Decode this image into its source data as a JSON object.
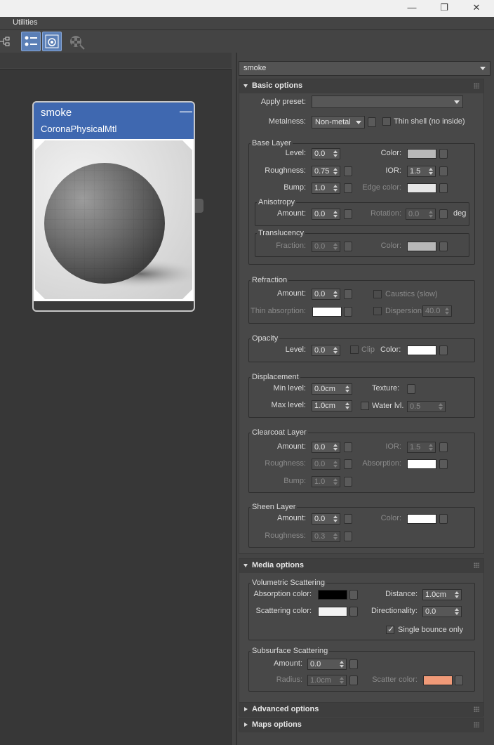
{
  "menu": {
    "utilities": "Utilities"
  },
  "window_controls": {
    "minimize": "—",
    "restore": "❐",
    "close": "✕"
  },
  "node": {
    "title": "smoke",
    "subtitle": "CoronaPhysicalMtl",
    "minimize": "—"
  },
  "material_select": {
    "value": "smoke"
  },
  "basic": {
    "title": "Basic options",
    "apply_preset": {
      "label": "Apply preset:",
      "value": ""
    },
    "metalness": {
      "label": "Metalness:",
      "value": "Non-metal"
    },
    "thin_shell": {
      "label": "Thin shell (no inside)",
      "checked": false
    },
    "base_layer": {
      "title": "Base Layer",
      "level": {
        "label": "Level:",
        "value": "0.0"
      },
      "color": {
        "label": "Color:",
        "swatch": "#b8b8b8"
      },
      "roughness": {
        "label": "Roughness:",
        "value": "0.75"
      },
      "ior": {
        "label": "IOR:",
        "value": "1.5"
      },
      "bump": {
        "label": "Bump:",
        "value": "1.0"
      },
      "edge_color": {
        "label": "Edge color:",
        "swatch": "#e6e6e6"
      }
    },
    "anisotropy": {
      "title": "Anisotropy",
      "amount": {
        "label": "Amount:",
        "value": "0.0"
      },
      "rotation": {
        "label": "Rotation:",
        "value": "0.0"
      },
      "unit": "deg"
    },
    "translucency": {
      "title": "Translucency",
      "fraction": {
        "label": "Fraction:",
        "value": "0.0"
      },
      "color": {
        "label": "Color:",
        "swatch": "#b8b8b8"
      }
    },
    "refraction": {
      "title": "Refraction",
      "amount": {
        "label": "Amount:",
        "value": "0.0"
      },
      "caustics": {
        "label": "Caustics (slow)"
      },
      "thin_absorption": {
        "label": "Thin absorption:",
        "swatch": "#ffffff"
      },
      "dispersion": {
        "label": "Dispersion",
        "value": "40.0"
      }
    },
    "opacity": {
      "title": "Opacity",
      "level": {
        "label": "Level:",
        "value": "0.0"
      },
      "clip": {
        "label": "Clip"
      },
      "color": {
        "label": "Color:",
        "swatch": "#ffffff"
      }
    },
    "displacement": {
      "title": "Displacement",
      "min": {
        "label": "Min level:",
        "value": "0.0cm"
      },
      "max": {
        "label": "Max level:",
        "value": "1.0cm"
      },
      "texture": {
        "label": "Texture:"
      },
      "water": {
        "label": "Water lvl.",
        "value": "0.5"
      }
    },
    "clearcoat": {
      "title": "Clearcoat Layer",
      "amount": {
        "label": "Amount:",
        "value": "0.0"
      },
      "ior": {
        "label": "IOR:",
        "value": "1.5"
      },
      "roughness": {
        "label": "Roughness:",
        "value": "0.0"
      },
      "absorption": {
        "label": "Absorption:",
        "swatch": "#ffffff"
      },
      "bump": {
        "label": "Bump:",
        "value": "1.0"
      }
    },
    "sheen": {
      "title": "Sheen Layer",
      "amount": {
        "label": "Amount:",
        "value": "0.0"
      },
      "color": {
        "label": "Color:",
        "swatch": "#ffffff"
      },
      "roughness": {
        "label": "Roughness:",
        "value": "0.3"
      }
    }
  },
  "media": {
    "title": "Media options",
    "volumetric": {
      "title": "Volumetric Scattering",
      "absorption_color": {
        "label": "Absorption color:",
        "swatch": "#000000"
      },
      "distance": {
        "label": "Distance:",
        "value": "1.0cm"
      },
      "scattering_color": {
        "label": "Scattering color:",
        "swatch": "#f2f2f2"
      },
      "directionality": {
        "label": "Directionality:",
        "value": "0.0"
      },
      "single_bounce": {
        "label": "Single bounce only",
        "checked": true
      }
    },
    "subsurface": {
      "title": "Subsurface Scattering",
      "amount": {
        "label": "Amount:",
        "value": "0.0"
      },
      "radius": {
        "label": "Radius:",
        "value": "1.0cm"
      },
      "scatter_color": {
        "label": "Scatter color:",
        "swatch": "#f09a78"
      }
    }
  },
  "advanced": {
    "title": "Advanced options"
  },
  "maps": {
    "title": "Maps options"
  }
}
